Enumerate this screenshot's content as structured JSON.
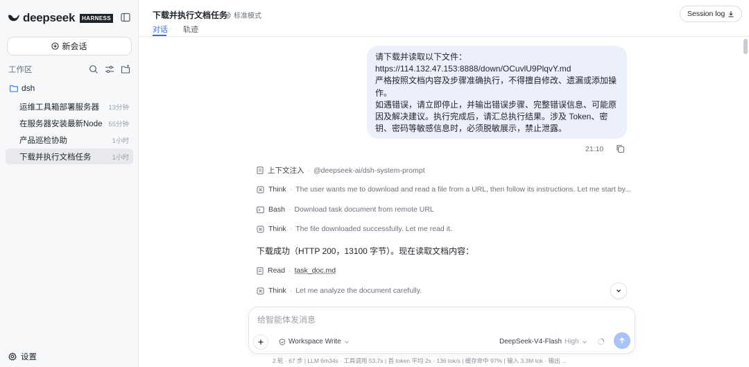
{
  "brand": {
    "name": "deepseek",
    "tag": "HARNESS"
  },
  "sidebar": {
    "new_chat_label": "新会话",
    "workspace_label": "工作区",
    "folder_name": "dsh",
    "sessions": [
      {
        "title": "运维工具箱部署服务器",
        "time": "13分钟"
      },
      {
        "title": "在服务器安装最新Node",
        "time": "55分钟"
      },
      {
        "title": "产品巡检协助",
        "time": "1小时"
      },
      {
        "title": "下载并执行文档任务",
        "time": "1小时"
      }
    ],
    "settings_label": "设置"
  },
  "header": {
    "title": "下载并执行文档任务",
    "mode": "标准模式",
    "tabs": [
      {
        "label": "对话"
      },
      {
        "label": "轨迹"
      }
    ],
    "session_log_label": "Session log"
  },
  "conversation": {
    "user_message": {
      "lines": [
        "请下载并读取以下文件：",
        "https://114.132.47.153:8888/down/OCuvlU9PlqvY.md",
        "严格按照文档内容及步骤准确执行，不得擅自修改、遗漏或添加操作。",
        "如遇错误，请立即停止，并输出错误步骤、完整错误信息、可能原因及解决建议。执行完成后，请汇总执行结果。涉及 Token、密钥、密码等敏感信息时，必须脱敏展示，禁止泄露。"
      ],
      "time": "21:10"
    },
    "steps": [
      {
        "icon": "document-icon",
        "label": "上下文注入",
        "desc": "@deepseek-ai/dsh-system-prompt"
      },
      {
        "icon": "brain-icon",
        "label": "Think",
        "desc": "The user wants me to download and read a file from a URL, then follow its instructions. Let me start by..."
      },
      {
        "icon": "terminal-icon",
        "label": "Bash",
        "desc": "Download task document from remote URL"
      },
      {
        "icon": "brain-icon",
        "label": "Think",
        "desc": "The file downloaded successfully. Let me read it."
      }
    ],
    "assistant_text": "下载成功（HTTP 200，13100 字节）。现在读取文档内容：",
    "read_step": {
      "label": "Read",
      "file": "task_doc.md"
    },
    "think_step": {
      "label": "Think",
      "desc": "Let me analyze the document carefully."
    }
  },
  "composer": {
    "placeholder": "给智能体发消息",
    "workspace_mode": "Workspace Write",
    "model": "DeepSeek-V4-Flash",
    "model_level": "High"
  },
  "status_bar": "2 轮 · 67 步  |  LLM 6m34s · 工具调用 53.7s  |  首 token 平均 2s · 136 tok/s  |  缓存命中 97%  |  输入 3.3M tok · 输出 ...",
  "colors": {
    "accent": "#2f6ff5",
    "bubble": "#ebf0fc",
    "send_button": "#a9c2f7"
  }
}
